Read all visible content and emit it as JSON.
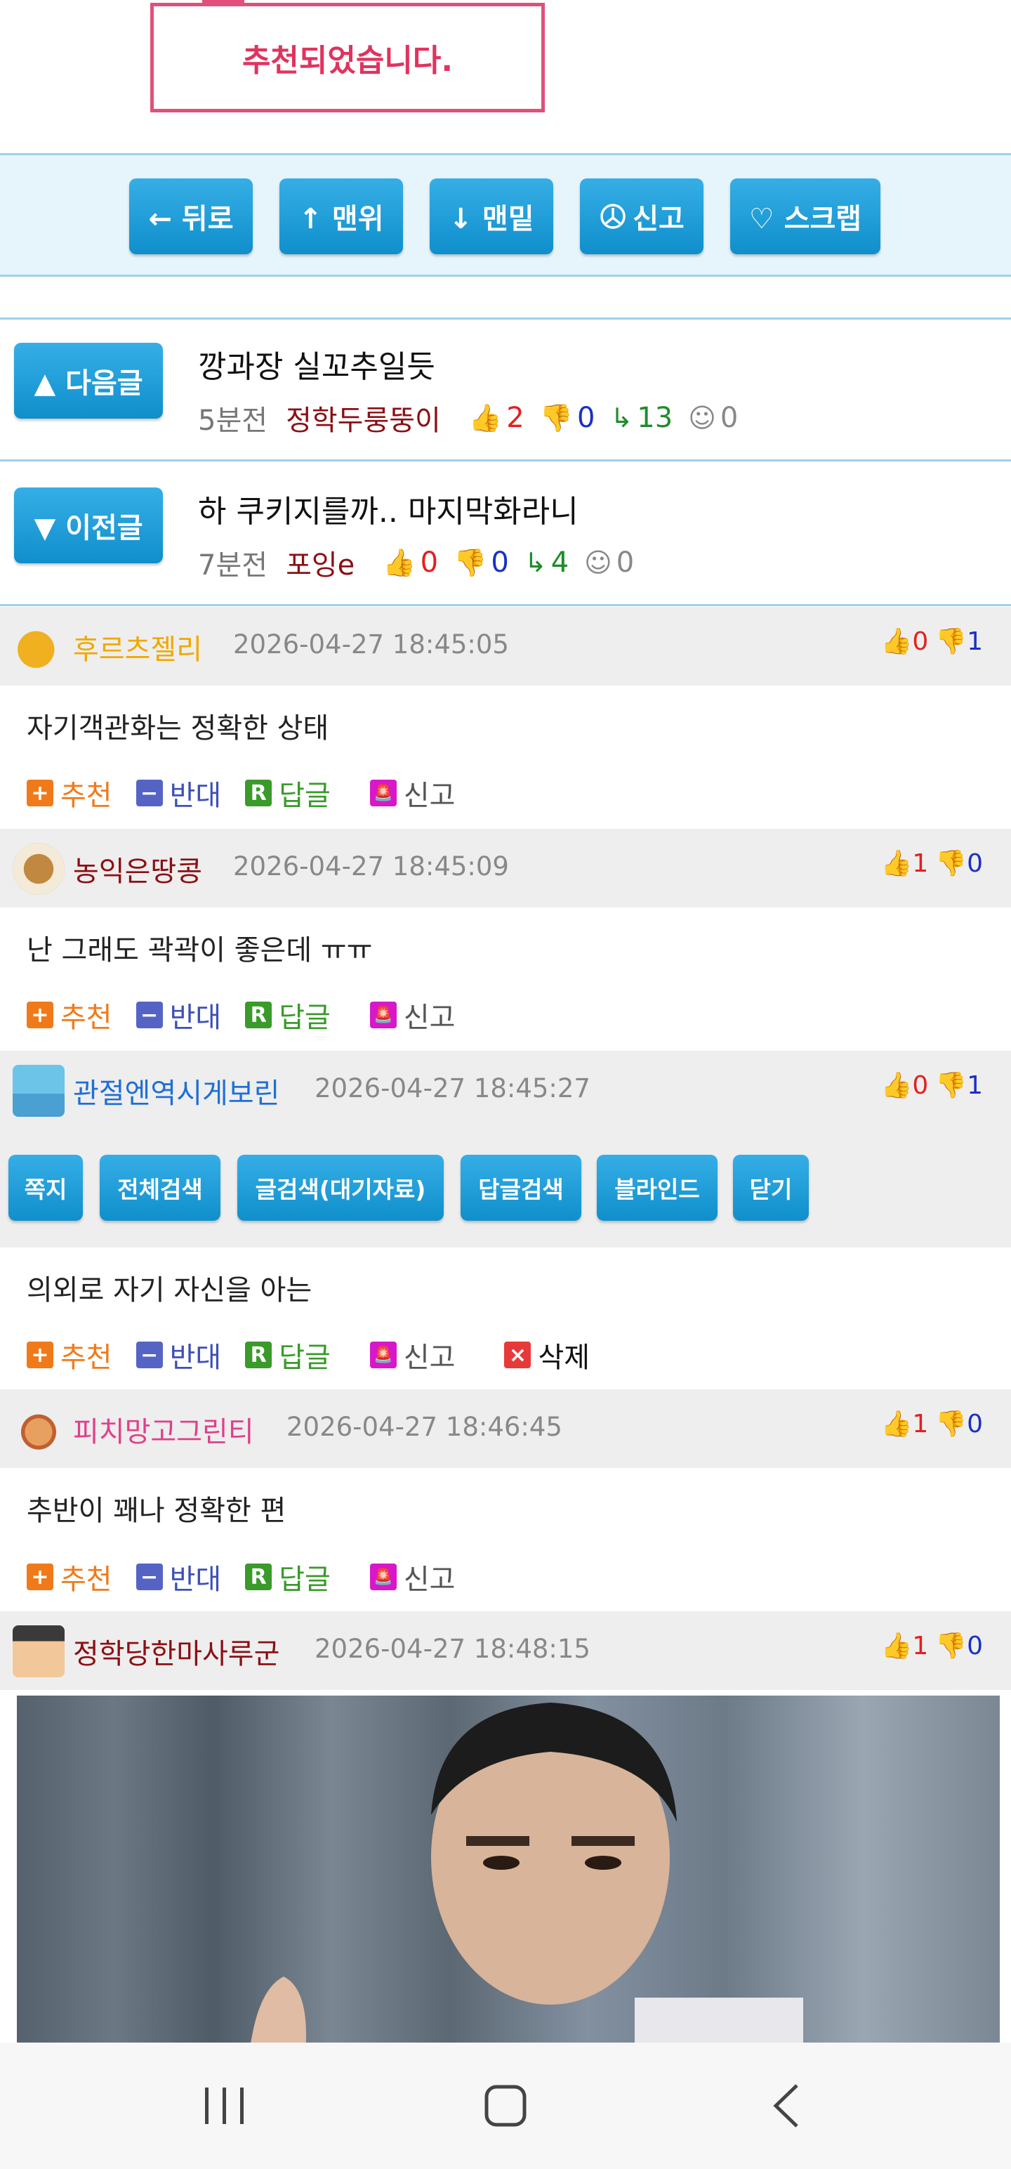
{
  "toast": {
    "message": "추천되었습니다."
  },
  "action_bar": {
    "back": "← 뒤로",
    "top": "↑ 맨위",
    "bottom": "↓ 맨밑",
    "report": "신고",
    "scrap": "♡ 스크랩"
  },
  "nav": {
    "next": {
      "button": "▲ 다음글",
      "title": "깡과장 실꼬추일듯",
      "time": "5분전",
      "author": "정학두룽뚱이",
      "up": "2",
      "down": "0",
      "replies": "13",
      "emote": "0"
    },
    "prev": {
      "button": "▼ 이전글",
      "title": "하 쿠키지를까.. 마지막화라니",
      "time": "7분전",
      "author": "포잉e",
      "up": "0",
      "down": "0",
      "replies": "4",
      "emote": "0"
    }
  },
  "comment_actions": {
    "recommend": "추천",
    "oppose": "반대",
    "reply": "답글",
    "report": "신고",
    "delete": "삭제"
  },
  "comments": [
    {
      "author": "후르츠젤리",
      "author_color": "#f0a800",
      "date": "2026-04-27 18:45:05",
      "up": "0",
      "down": "1",
      "body": "자기객관화는 정확한 상태"
    },
    {
      "author": "농익은땅콩",
      "author_color": "#8b0f14",
      "date": "2026-04-27 18:45:09",
      "up": "1",
      "down": "0",
      "body": "난 그래도 곽곽이 좋은데 ㅠㅠ"
    },
    {
      "author": "관절엔역시게보린",
      "author_color": "#1f6fd6",
      "date": "2026-04-27 18:45:27",
      "up": "0",
      "down": "1",
      "body": "의외로 자기 자신을 아는"
    },
    {
      "author": "피치망고그린티",
      "author_color": "#e0408a",
      "date": "2026-04-27 18:46:45",
      "up": "1",
      "down": "0",
      "body": "추반이 꽤나 정확한 편"
    },
    {
      "author": "정학당한마사루군",
      "author_color": "#8b0f14",
      "date": "2026-04-27 18:48:15",
      "up": "1",
      "down": "0"
    }
  ],
  "user_menu": [
    "쪽지",
    "전체검색",
    "글검색(대기자료)",
    "답글검색",
    "블라인드",
    "닫기"
  ],
  "colors": {
    "accent_blue": "#1a9ad8",
    "toast_pink": "#e0335e",
    "up_red": "#e32020",
    "down_blue": "#1a2fc8"
  },
  "icons": {
    "thumb_up": "thumb-up-icon",
    "thumb_down": "thumb-down-icon",
    "reply": "reply-arrow-icon",
    "emote": "smiley-icon"
  }
}
